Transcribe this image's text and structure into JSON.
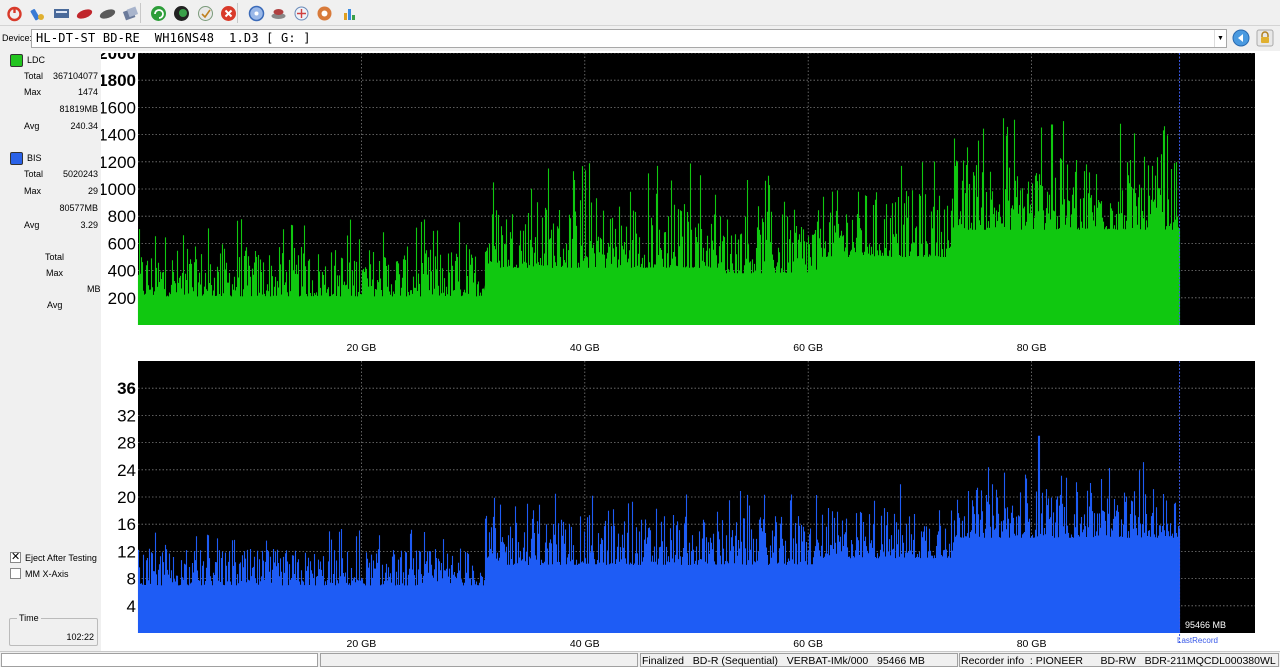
{
  "toolbar": {
    "buttons": [
      {
        "name": "power-icon",
        "color": "#d83a2a"
      },
      {
        "name": "tools-icon",
        "color": "#3a7bd5"
      },
      {
        "name": "drive-icon",
        "color": "#4a6a9a"
      },
      {
        "name": "disc-red-icon",
        "color": "#c0262c"
      },
      {
        "name": "disc-gray-icon",
        "color": "#5a5a5a"
      },
      {
        "name": "copy-icon",
        "color": "#6a7a9a"
      },
      {
        "name": "refresh-icon",
        "color": "#2e9e3a"
      },
      {
        "name": "globe-icon",
        "color": "#2a6a3a"
      },
      {
        "name": "check-icon",
        "color": "#7a9a7a"
      },
      {
        "name": "stop-icon",
        "color": "#d93a2a"
      },
      {
        "name": "blue-disc-icon",
        "color": "#3a6ab8"
      },
      {
        "name": "disc-stack-icon",
        "color": "#b04040"
      },
      {
        "name": "network-icon",
        "color": "#6a8ab8"
      },
      {
        "name": "settings-icon",
        "color": "#d87a3a"
      },
      {
        "name": "chart-icon",
        "color": "#e0a020"
      }
    ]
  },
  "device": {
    "label": "Device:",
    "value": "HL-DT-ST BD-RE  WH16NS48  1.D3 [ G: ]"
  },
  "stats": {
    "ldc": {
      "name": "LDC",
      "color": "#22c41f",
      "total_label": "Total",
      "total": "367104077",
      "max_label": "Max",
      "max": "1474",
      "max_pos": "81819MB",
      "avg_label": "Avg",
      "avg": "240.34"
    },
    "bis": {
      "name": "BIS",
      "color": "#2a62e8",
      "total_label": "Total",
      "total": "5020243",
      "max_label": "Max",
      "max": "29",
      "max_pos": "80577MB",
      "avg_label": "Avg",
      "avg": "3.29"
    },
    "third": {
      "total_label": "Total",
      "max_label": "Max",
      "mb_label": "MB",
      "avg_label": "Avg"
    }
  },
  "options": {
    "eject_label": "Eject After Testing",
    "eject_checked": true,
    "mm_label": "MM X-Axis",
    "mm_checked": false
  },
  "time": {
    "label": "Time",
    "value": "102:22"
  },
  "chart_data": [
    {
      "type": "area",
      "series": [
        {
          "name": "LDC",
          "color": "#10c810"
        }
      ],
      "xlim": [
        0,
        100
      ],
      "ylim": [
        0,
        2000
      ],
      "x_ticks": [
        "20 GB",
        "40 GB",
        "60 GB",
        "80 GB"
      ],
      "x_tick_values": [
        20,
        40,
        60,
        80
      ],
      "y_ticks": [
        "200",
        "400",
        "600",
        "800",
        "1000",
        "1200",
        "1400",
        "1600",
        "1800",
        "2000"
      ],
      "y_tick_values": [
        200,
        400,
        600,
        800,
        1000,
        1200,
        1400,
        1600,
        1800,
        2000
      ],
      "data_end_x": 93.2,
      "segments": [
        {
          "x0": 0,
          "x1": 31,
          "base": 210,
          "peak": 620
        },
        {
          "x0": 31,
          "x1": 52,
          "base": 420,
          "peak": 980
        },
        {
          "x0": 52,
          "x1": 61,
          "base": 380,
          "peak": 900
        },
        {
          "x0": 61,
          "x1": 73,
          "base": 500,
          "peak": 1050
        },
        {
          "x0": 73,
          "x1": 93.2,
          "base": 700,
          "peak": 1300
        }
      ],
      "max_value": 1474,
      "max_at": 81.8,
      "grid": true,
      "background": "#000000"
    },
    {
      "type": "area",
      "series": [
        {
          "name": "BIS",
          "color": "#1e5cf5"
        }
      ],
      "xlim": [
        0,
        100
      ],
      "ylim": [
        0,
        40
      ],
      "x_ticks": [
        "20 GB",
        "40 GB",
        "60 GB",
        "80 GB"
      ],
      "x_tick_values": [
        20,
        40,
        60,
        80
      ],
      "y_ticks": [
        "4",
        "8",
        "12",
        "16",
        "20",
        "24",
        "28",
        "32",
        "36"
      ],
      "y_tick_values": [
        4,
        8,
        12,
        16,
        20,
        24,
        28,
        32,
        36
      ],
      "data_end_x": 93.2,
      "segments": [
        {
          "x0": 0,
          "x1": 31,
          "base": 7,
          "peak": 13
        },
        {
          "x0": 31,
          "x1": 52,
          "base": 10,
          "peak": 18
        },
        {
          "x0": 52,
          "x1": 61,
          "base": 10,
          "peak": 18
        },
        {
          "x0": 61,
          "x1": 73,
          "base": 11,
          "peak": 19
        },
        {
          "x0": 73,
          "x1": 93.2,
          "base": 14,
          "peak": 22
        }
      ],
      "max_value": 29,
      "max_at": 80.6,
      "end_label": "95466 MB",
      "last_record_label": "LastRecord",
      "grid": true,
      "background": "#000000"
    }
  ],
  "status": {
    "left": "",
    "middle": "",
    "disc": "Finalized   BD-R (Sequential)   VERBAT-IMk/000   95466 MB",
    "recorder": "Recorder info  : PIONEER      BD-RW   BDR-211MQCDL000380WL"
  }
}
